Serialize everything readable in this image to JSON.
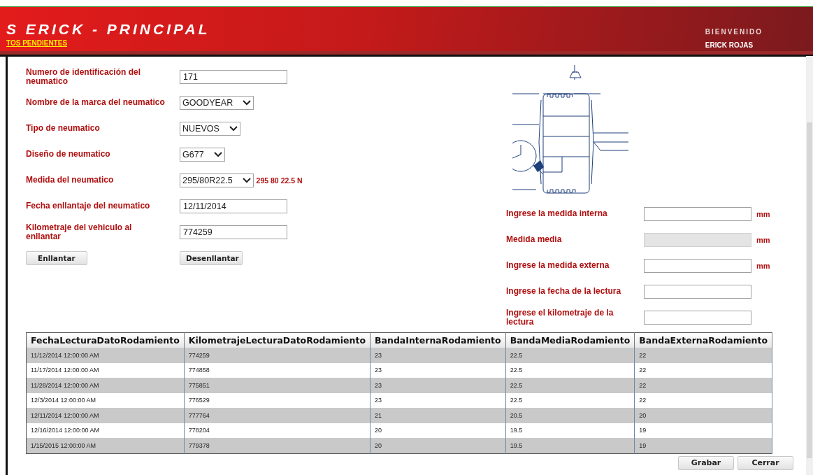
{
  "header": {
    "title": "S ERICK - PRINCIPAL",
    "link": "TOS PENDIENTES",
    "greeting": "BIENVENIDO",
    "user": "ERICK ROJAS"
  },
  "form": {
    "fields": [
      {
        "kind": "text",
        "label": "Numero de identificación del neumatico",
        "value": "171"
      },
      {
        "kind": "select",
        "label": "Nombre de la marca del neumatico",
        "value": "GOODYEAR"
      },
      {
        "kind": "select",
        "label": "Tipo de neumatico",
        "value": "NUEVOS"
      },
      {
        "kind": "select",
        "label": "Diseño de neumatico",
        "value": "G677"
      },
      {
        "kind": "select",
        "label": "Medida del neumatico",
        "value": "295/80R22.5",
        "note": "295 80 22.5 N"
      },
      {
        "kind": "text",
        "label": "Fecha enllantaje del neumatico",
        "value": "12/11/2014"
      },
      {
        "kind": "text",
        "label": "Kilometraje del vehiculo al enllantar",
        "value": "774259"
      }
    ],
    "buttons": [
      "Enllantar",
      "Desenllantar"
    ]
  },
  "readings": [
    {
      "label": "Ingrese la medida interna",
      "unit": "mm",
      "disabled": false
    },
    {
      "label": "Medida media",
      "unit": "mm",
      "disabled": true
    },
    {
      "label": "Ingrese la medida externa",
      "unit": "mm",
      "disabled": false
    },
    {
      "label": "Ingrese la fecha de la lectura",
      "disabled": false
    },
    {
      "label": "Ingrese el kilometraje de la lectura",
      "disabled": false
    }
  ],
  "table": {
    "columns": [
      "FechaLecturaDatoRodamiento",
      "KilometrajeLecturaDatoRodamiento",
      "BandaInternaRodamiento",
      "BandaMediaRodamiento",
      "BandaExternaRodamiento"
    ],
    "rows": [
      [
        "11/12/2014 12:00:00 AM",
        "774259",
        "23",
        "22.5",
        "22"
      ],
      [
        "11/17/2014 12:00:00 AM",
        "774858",
        "23",
        "22.5",
        "22"
      ],
      [
        "11/28/2014 12:00:00 AM",
        "775851",
        "23",
        "22.5",
        "22"
      ],
      [
        "12/3/2014 12:00:00 AM",
        "776529",
        "23",
        "22.5",
        "22"
      ],
      [
        "12/11/2014 12:00:00 AM",
        "777764",
        "21",
        "20.5",
        "20"
      ],
      [
        "12/16/2014 12:00:00 AM",
        "778204",
        "20",
        "19.5",
        "19"
      ],
      [
        "1/15/2015 12:00:00 AM",
        "779378",
        "20",
        "19.5",
        "19"
      ]
    ]
  },
  "footer_buttons": [
    "Grabar",
    "Cerrar"
  ]
}
